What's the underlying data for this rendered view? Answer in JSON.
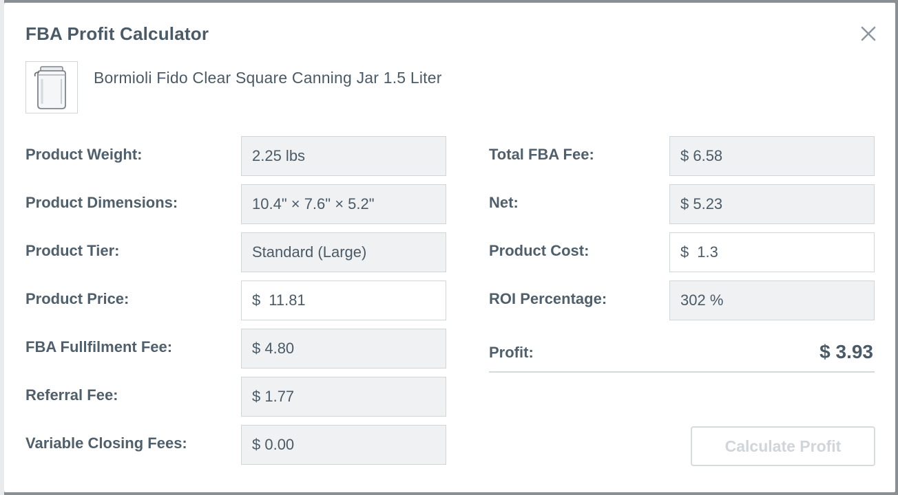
{
  "dialog": {
    "title": "FBA Profit Calculator",
    "product_name": "Bormioli Fido Clear Square Canning Jar 1.5 Liter",
    "thumbnail_icon": "canning-jar-icon",
    "close_icon": "close-icon"
  },
  "left": {
    "weight": {
      "label": "Product Weight:",
      "value": "2.25 lbs"
    },
    "dimensions": {
      "label": "Product Dimensions:",
      "value": "10.4\" × 7.6\" × 5.2\""
    },
    "tier": {
      "label": "Product Tier:",
      "value": "Standard (Large)"
    },
    "price": {
      "label": "Product Price:",
      "currency": "$",
      "value": "11.81"
    },
    "fulfilment_fee": {
      "label": "FBA Fullfilment Fee:",
      "value": "$ 4.80"
    },
    "referral_fee": {
      "label": "Referral Fee:",
      "value": "$ 1.77"
    },
    "closing_fees": {
      "label": "Variable Closing Fees:",
      "value": "$ 0.00"
    }
  },
  "right": {
    "total_fee": {
      "label": "Total FBA Fee:",
      "value": "$ 6.58"
    },
    "net": {
      "label": "Net:",
      "value": "$ 5.23"
    },
    "cost": {
      "label": "Product Cost:",
      "currency": "$",
      "value": "1.3"
    },
    "roi": {
      "label": "ROI Percentage:",
      "value": "302 %"
    },
    "profit": {
      "label": "Profit:",
      "value": "$ 3.93"
    }
  },
  "actions": {
    "calculate_label": "Calculate Profit"
  },
  "colors": {
    "text": "#4a5a66",
    "readonly_bg": "#f0f1f2",
    "border": "#cfd5d9",
    "disabled_text": "#cfd5d9"
  }
}
